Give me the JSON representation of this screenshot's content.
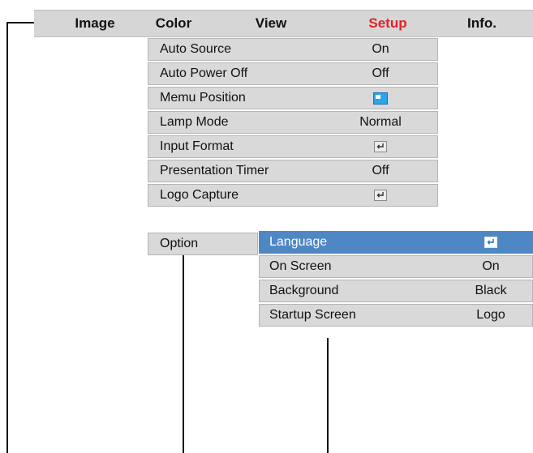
{
  "tabs": [
    {
      "label": "Image",
      "active": false
    },
    {
      "label": "Color",
      "active": false
    },
    {
      "label": "View",
      "active": false
    },
    {
      "label": "Setup",
      "active": true
    },
    {
      "label": "Info.",
      "active": false
    }
  ],
  "setup_menu": {
    "items": [
      {
        "label": "Auto Source",
        "value": "On"
      },
      {
        "label": "Auto Power Off",
        "value": "Off"
      },
      {
        "label": "Memu Position",
        "value": "",
        "icon": "menu-position-icon"
      },
      {
        "label": "Lamp Mode",
        "value": "Normal"
      },
      {
        "label": "Input Format",
        "value": "",
        "icon": "enter-icon"
      },
      {
        "label": "Presentation Timer",
        "value": "Off"
      },
      {
        "label": "Logo Capture",
        "value": "",
        "icon": "enter-icon"
      }
    ],
    "option_label": "Option"
  },
  "option_menu": {
    "items": [
      {
        "label": "Language",
        "value": "",
        "icon": "enter-icon",
        "selected": true
      },
      {
        "label": "On Screen",
        "value": "On"
      },
      {
        "label": "Background",
        "value": "Black"
      },
      {
        "label": "Startup Screen",
        "value": "Logo"
      }
    ]
  },
  "colors": {
    "active_tab": "#e0232a",
    "selected_row": "#4f87c4",
    "menu_bg": "#d9d9d9"
  }
}
